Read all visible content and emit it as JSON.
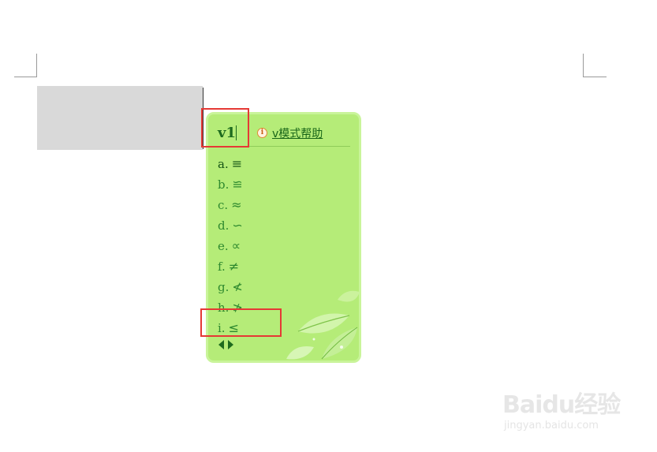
{
  "ime": {
    "input_text": "v1",
    "help_icon_glyph": "i",
    "help_link": "v模式帮助",
    "candidates": [
      {
        "label": "a.",
        "symbol": "≡"
      },
      {
        "label": "b.",
        "symbol": "≌"
      },
      {
        "label": "c.",
        "symbol": "≈"
      },
      {
        "label": "d.",
        "symbol": "∽"
      },
      {
        "label": "e.",
        "symbol": "∝"
      },
      {
        "label": "f.",
        "symbol": "≠"
      },
      {
        "label": "g.",
        "symbol": "≮"
      },
      {
        "label": "h.",
        "symbol": "≯"
      },
      {
        "label": "i.",
        "symbol": "≤"
      }
    ]
  },
  "watermark": {
    "brand": "Baidu经验",
    "url": "jingyan.baidu.com"
  },
  "colors": {
    "panel_bg": "#b5ec78",
    "panel_border": "#c9f49a",
    "highlight_box": "#e53935",
    "selection": "#d9d9d9"
  }
}
